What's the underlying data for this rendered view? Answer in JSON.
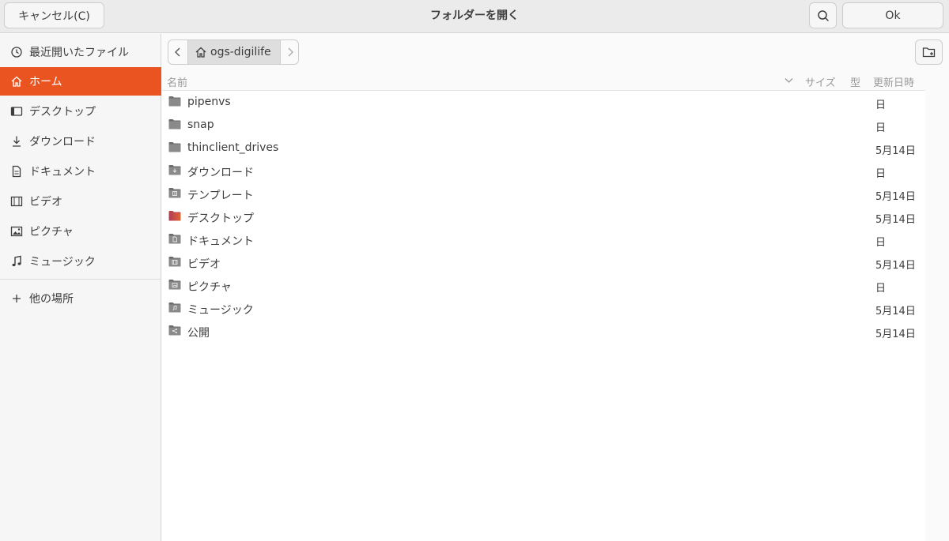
{
  "header": {
    "title": "フォルダーを開く",
    "cancel_label": "キャンセル(C)",
    "ok_label": "Ok"
  },
  "sidebar": {
    "items": [
      {
        "label": "最近開いたファイル",
        "icon": "recent-icon"
      },
      {
        "label": "ホーム",
        "icon": "home-icon",
        "active": true
      },
      {
        "label": "デスクトップ",
        "icon": "desktop-icon"
      },
      {
        "label": "ダウンロード",
        "icon": "download-icon"
      },
      {
        "label": "ドキュメント",
        "icon": "document-icon"
      },
      {
        "label": "ビデオ",
        "icon": "video-icon"
      },
      {
        "label": "ピクチャ",
        "icon": "picture-icon"
      },
      {
        "label": "ミュージック",
        "icon": "music-icon"
      }
    ],
    "other_locations": {
      "label": "他の場所",
      "icon": "plus-icon"
    }
  },
  "path": {
    "current": "ogs-digilife"
  },
  "columns": {
    "name": "名前",
    "size": "サイズ",
    "type": "型",
    "modified": "更新日時"
  },
  "files": [
    {
      "name": "pipenvs",
      "modified": "日",
      "icon": "folder-icon"
    },
    {
      "name": "snap",
      "modified": "日",
      "icon": "folder-icon"
    },
    {
      "name": "thinclient_drives",
      "modified": "5月14日",
      "icon": "folder-icon"
    },
    {
      "name": "ダウンロード",
      "modified": "日",
      "icon": "folder-download-icon"
    },
    {
      "name": "テンプレート",
      "modified": "5月14日",
      "icon": "folder-templates-icon"
    },
    {
      "name": "デスクトップ",
      "modified": "5月14日",
      "icon": "folder-desktop-icon"
    },
    {
      "name": "ドキュメント",
      "modified": "日",
      "icon": "folder-documents-icon"
    },
    {
      "name": "ビデオ",
      "modified": "5月14日",
      "icon": "folder-videos-icon"
    },
    {
      "name": "ピクチャ",
      "modified": "日",
      "icon": "folder-pictures-icon"
    },
    {
      "name": "ミュージック",
      "modified": "5月14日",
      "icon": "folder-music-icon"
    },
    {
      "name": "公開",
      "modified": "5月14日",
      "icon": "folder-public-icon"
    }
  ],
  "colors": {
    "accent": "#e95420",
    "folder": "#6b6b6b"
  }
}
